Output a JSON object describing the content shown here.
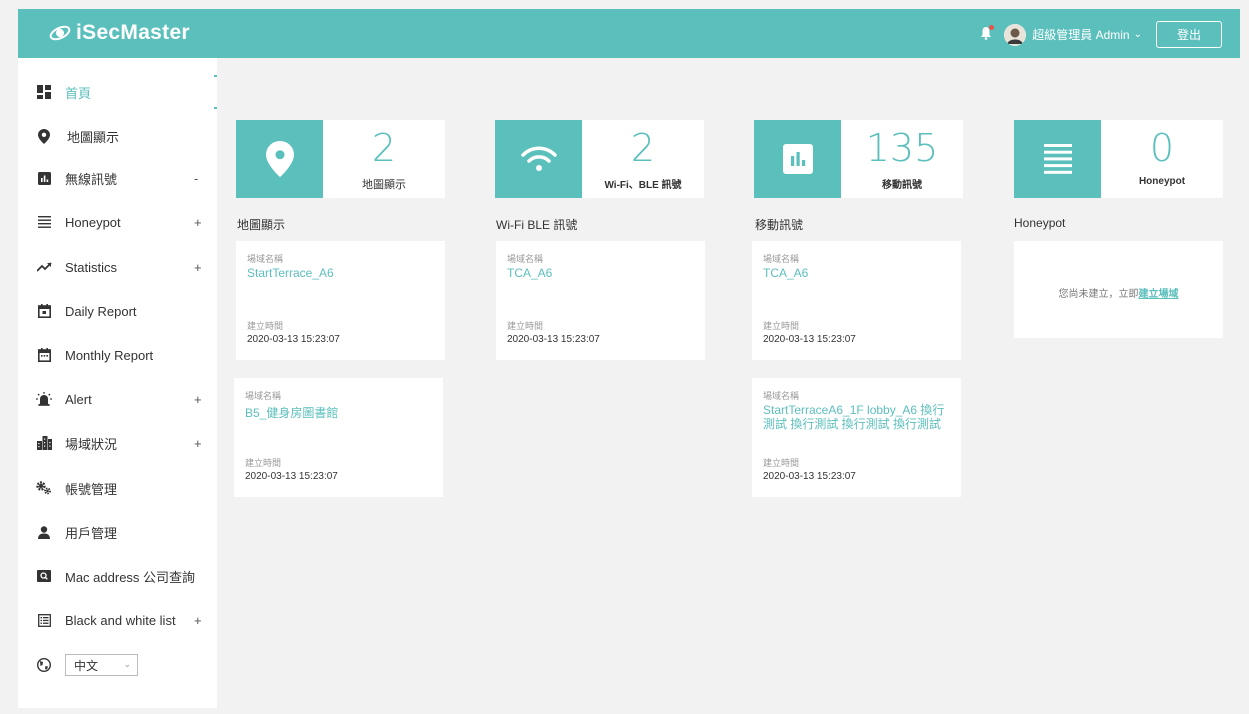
{
  "header": {
    "app_name": "iSecMaster",
    "user_label": "超級管理員 Admin",
    "logout_label": "登出"
  },
  "sidebar": {
    "items": [
      {
        "label": "首頁",
        "icon": "dashboard-icon",
        "toggle": ""
      },
      {
        "label": "地圖顯示",
        "icon": "map-pin-icon",
        "toggle": ""
      },
      {
        "label": "無線訊號",
        "icon": "bar-chart-icon",
        "toggle": "-"
      },
      {
        "label": "Honeypot",
        "icon": "list-icon",
        "toggle": "+"
      },
      {
        "label": "Statistics",
        "icon": "trend-icon",
        "toggle": "+"
      },
      {
        "label": "Daily Report",
        "icon": "calendar-day-icon",
        "toggle": ""
      },
      {
        "label": "Monthly Report",
        "icon": "calendar-month-icon",
        "toggle": ""
      },
      {
        "label": "Alert",
        "icon": "alarm-icon",
        "toggle": "+"
      },
      {
        "label": "場域狀況",
        "icon": "building-icon",
        "toggle": "+"
      },
      {
        "label": "帳號管理",
        "icon": "gears-icon",
        "toggle": ""
      },
      {
        "label": "用戶管理",
        "icon": "user-icon",
        "toggle": ""
      },
      {
        "label": "Mac address 公司查詢",
        "icon": "search-box-icon",
        "toggle": ""
      },
      {
        "label": "Black and white list",
        "icon": "table-list-icon",
        "toggle": "+"
      }
    ],
    "language": {
      "selected": "中文",
      "icon": "globe-icon"
    }
  },
  "stats": [
    {
      "value": "2",
      "caption": "地圖顯示",
      "icon": "map-pin-icon"
    },
    {
      "value": "2",
      "caption": "Wi-Fi、BLE 訊號",
      "icon": "wifi-icon"
    },
    {
      "value": "135",
      "caption": "移動訊號",
      "icon": "bar-chart-icon"
    },
    {
      "value": "0",
      "caption": "Honeypot",
      "icon": "list-icon"
    }
  ],
  "sections": [
    {
      "title": "地圖顯示"
    },
    {
      "title": "Wi-Fi BLE 訊號"
    },
    {
      "title": "移動訊號"
    },
    {
      "title": "Honeypot"
    }
  ],
  "field_labels": {
    "site_name": "場域名稱",
    "created_time": "建立時間"
  },
  "cards": {
    "map": [
      {
        "name": "StartTerrace_A6",
        "time": "2020-03-13 15:23:07"
      },
      {
        "name": "B5_健身房圖書館",
        "time": "2020-03-13 15:23:07"
      }
    ],
    "wifi": [
      {
        "name": "TCA_A6",
        "time": "2020-03-13 15:23:07"
      }
    ],
    "mobile": [
      {
        "name": "TCA_A6",
        "time": "2020-03-13 15:23:07"
      },
      {
        "name": "StartTerraceA6_1F lobby_A6 換行測試 換行測試 換行測試 換行測試",
        "time": "2020-03-13 15:23:07"
      }
    ]
  },
  "honeypot_empty": {
    "message": "您尚未建立，立即",
    "link": "建立場域"
  },
  "colors": {
    "accent": "#5bbfbc",
    "alert_dot": "#e8534a"
  }
}
